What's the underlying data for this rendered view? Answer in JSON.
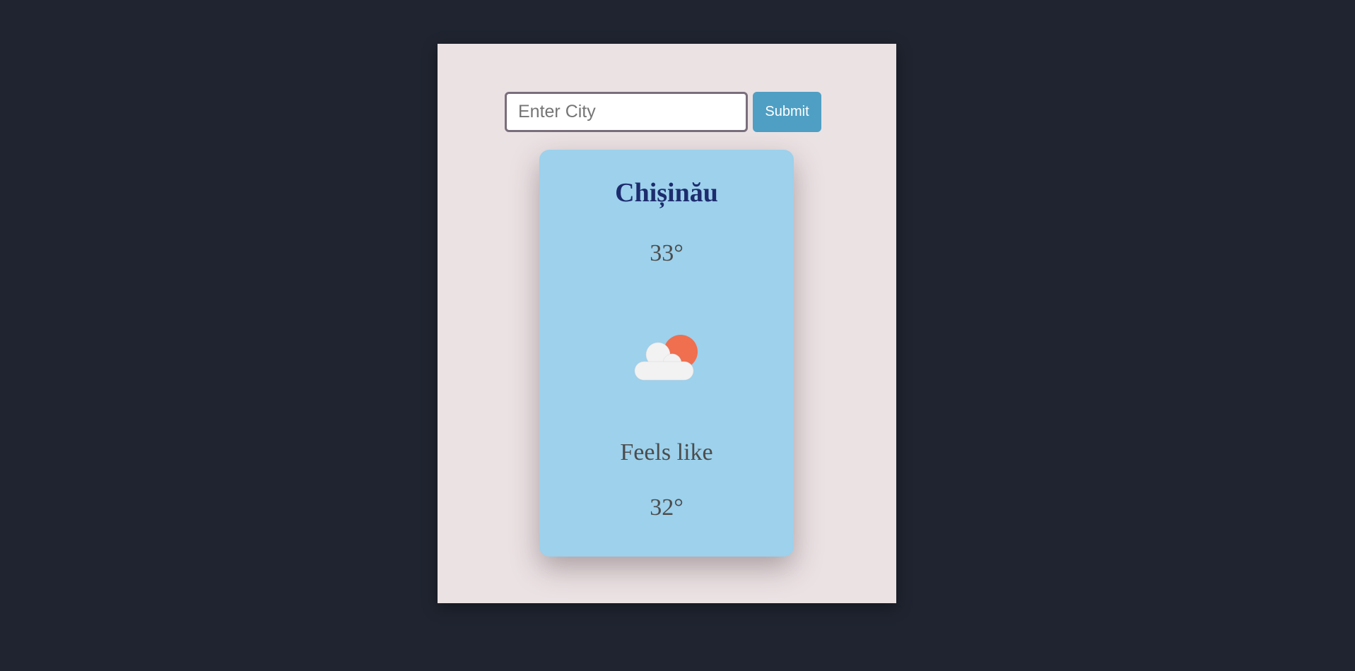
{
  "search": {
    "placeholder": "Enter City",
    "value": "",
    "submit_label": "Submit"
  },
  "weather": {
    "city": "Chișinău",
    "temperature": "33°",
    "icon": "partly-cloudy-day-icon",
    "feels_like_label": "Feels like",
    "feels_like_temperature": "32°"
  },
  "colors": {
    "background": "#1f2430",
    "panel": "#ebe2e4",
    "card": "#9dd1ec",
    "city_text": "#1d2c6e",
    "submit_button": "#4f9fc4",
    "sun": "#ef6f4f",
    "cloud": "#f2f2f2"
  }
}
